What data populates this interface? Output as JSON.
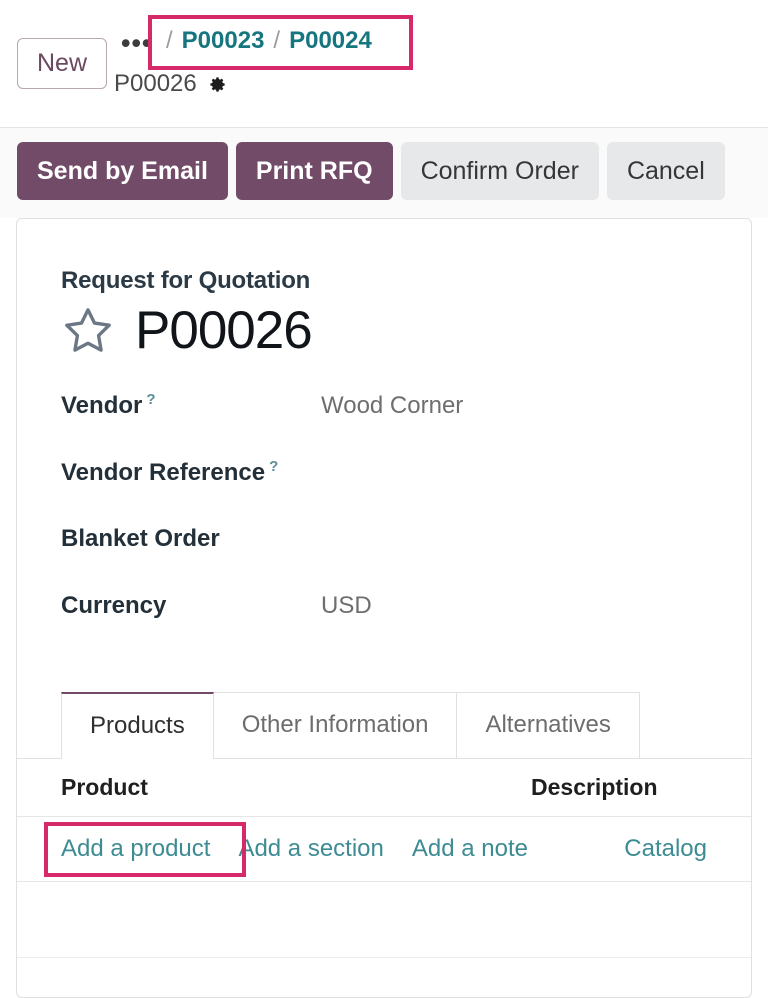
{
  "breadcrumb": {
    "new_label": "New",
    "ellipsis": "•••",
    "separator": "/",
    "links": [
      {
        "label": "P00023"
      },
      {
        "label": "P00024"
      }
    ],
    "current": "P00026",
    "gear_icon": "gear-icon"
  },
  "control_panel": {
    "buttons": [
      {
        "label": "Send by Email",
        "style": "primary"
      },
      {
        "label": "Print RFQ",
        "style": "primary"
      },
      {
        "label": "Confirm Order",
        "style": "secondary"
      },
      {
        "label": "Cancel",
        "style": "secondary"
      }
    ]
  },
  "form": {
    "subtitle": "Request for Quotation",
    "title": "P00026",
    "star_icon": "star-outline-icon",
    "fields": [
      {
        "label": "Vendor",
        "tip": "?",
        "value": "Wood Corner"
      },
      {
        "label": "Vendor Reference",
        "tip": "?",
        "value": ""
      },
      {
        "label": "Blanket Order",
        "tip": "",
        "value": ""
      },
      {
        "label": "Currency",
        "tip": "",
        "value": "USD"
      }
    ]
  },
  "tabs": [
    {
      "label": "Products",
      "active": true
    },
    {
      "label": "Other Information",
      "active": false
    },
    {
      "label": "Alternatives",
      "active": false
    }
  ],
  "list": {
    "columns": {
      "product": "Product",
      "description": "Description"
    },
    "actions": [
      {
        "label": "Add a product"
      },
      {
        "label": "Add a section"
      },
      {
        "label": "Add a note"
      }
    ],
    "catalog_label": "Catalog"
  },
  "colors": {
    "primary": "#714b67",
    "link_teal": "#3d8b93",
    "breadcrumb_link": "#16767f",
    "annotation": "#d6296a",
    "secondary_button": "#e6e8ea"
  }
}
